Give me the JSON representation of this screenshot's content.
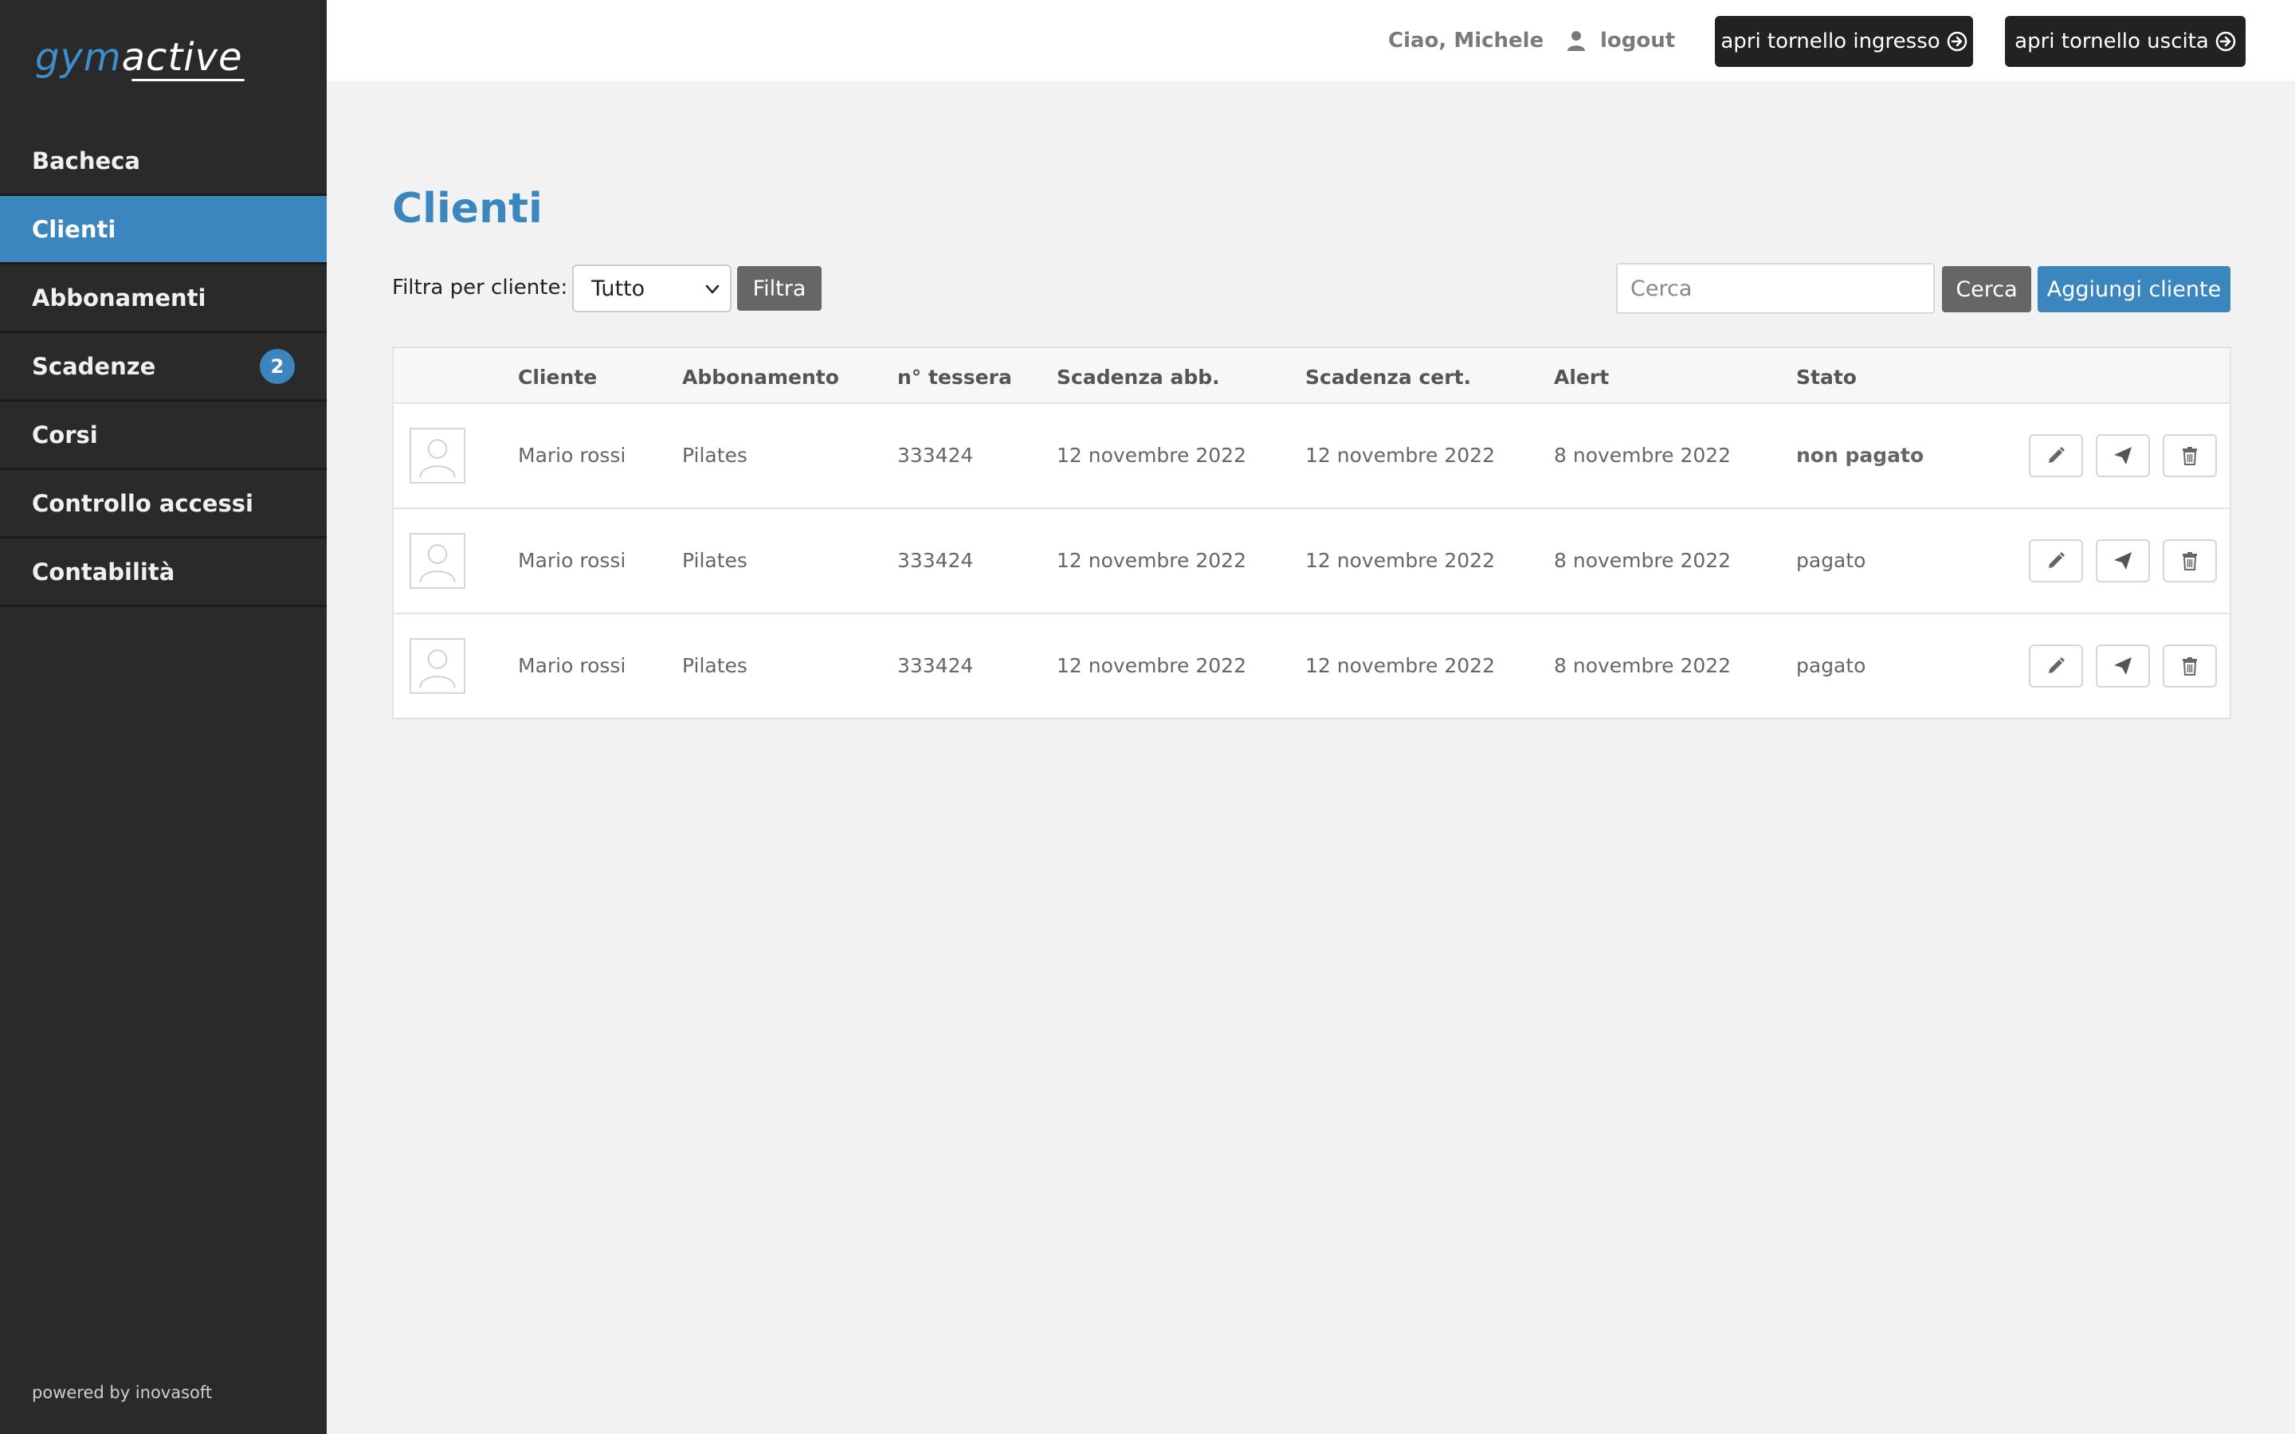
{
  "brand": {
    "part1": "gym",
    "part2": "active"
  },
  "sidebar": {
    "items": [
      {
        "label": "Bacheca",
        "active": false
      },
      {
        "label": "Clienti",
        "active": true
      },
      {
        "label": "Abbonamenti",
        "active": false
      },
      {
        "label": "Scadenze",
        "active": false,
        "badge": "2"
      },
      {
        "label": "Corsi",
        "active": false
      },
      {
        "label": "Controllo accessi",
        "active": false
      },
      {
        "label": "Contabilità",
        "active": false
      }
    ],
    "footer": "powered by inovasoft"
  },
  "header": {
    "greeting": "Ciao, Michele",
    "logout_label": "logout",
    "btn_entrance": "apri tornello ingresso",
    "btn_exit": "apri tornello uscita"
  },
  "main": {
    "title": "Clienti",
    "filter_label": "Filtra per cliente:",
    "filter_selected": "Tutto",
    "filter_button": "Filtra",
    "search_placeholder": "Cerca",
    "search_button": "Cerca",
    "add_button": "Aggiungi cliente"
  },
  "table": {
    "headers": [
      "Cliente",
      "Abbonamento",
      "n° tessera",
      "Scadenza abb.",
      "Scadenza cert.",
      "Alert",
      "Stato"
    ],
    "rows": [
      {
        "cliente": "Mario rossi",
        "abbonamento": "Pilates",
        "tessera": "333424",
        "scadenza_abb": "12 novembre 2022",
        "scadenza_cert": "12 novembre 2022",
        "alert": "8 novembre 2022",
        "stato": "non pagato"
      },
      {
        "cliente": "Mario rossi",
        "abbonamento": "Pilates",
        "tessera": "333424",
        "scadenza_abb": "12 novembre 2022",
        "scadenza_cert": "12 novembre 2022",
        "alert": "8 novembre 2022",
        "stato": "pagato"
      },
      {
        "cliente": "Mario rossi",
        "abbonamento": "Pilates",
        "tessera": "333424",
        "scadenza_abb": "12 novembre 2022",
        "scadenza_cert": "12 novembre 2022",
        "alert": "8 novembre 2022",
        "stato": "pagato"
      }
    ],
    "row_actions": [
      "pencil-icon",
      "paper-plane-icon",
      "trash-icon"
    ]
  },
  "colors": {
    "accent": "#3b86be",
    "sidebar_bg": "#2a2a2a",
    "page_bg": "#f2f2f2"
  }
}
